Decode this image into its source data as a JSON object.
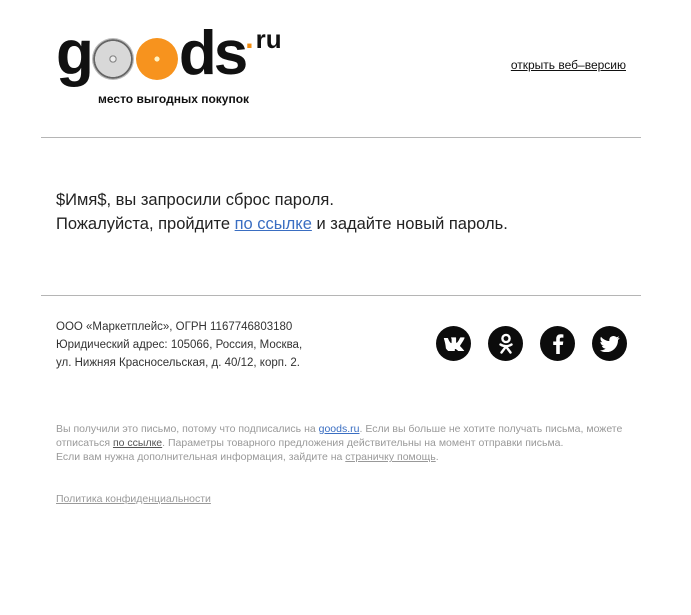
{
  "header": {
    "logo_g": "g",
    "logo_ds": "ds",
    "logo_dot": ".",
    "logo_ru": "ru",
    "tagline": "место выгодных покупок",
    "web_version_link": "открыть веб–версию"
  },
  "message": {
    "line1": "$Имя$, вы запросили сброс пароля.",
    "line2_before": "Пожалуйста, пройдите ",
    "line2_link": "по ссылке",
    "line2_after": " и задайте новый пароль."
  },
  "footer": {
    "legal_line1": "ООО «Маркетплейс», ОГРН 1167746803180",
    "legal_line2": "Юридический адрес: 105066, Россия, Москва,",
    "legal_line3": "ул. Нижняя Красносельская, д. 40/12, корп. 2.",
    "socials": [
      {
        "name": "vk-icon"
      },
      {
        "name": "odnoklassniki-icon"
      },
      {
        "name": "facebook-icon"
      },
      {
        "name": "twitter-icon"
      }
    ],
    "fine_1": "Вы получили это письмо, потому что подписались на ",
    "fine_goods_link": "goods.ru",
    "fine_2": ". Если вы больше не хотите получать письма, можете отписаться ",
    "fine_unsub_link": "по ссылке",
    "fine_3": ". Параметры товарного предложения действительны на момент отправки письма.",
    "fine_4": "Если вам нужна дополнительная информация, зайдите на ",
    "fine_help_link": "страничку помощь",
    "fine_5": ".",
    "policy_link": "Политика конфиденциальности"
  },
  "colors": {
    "link_blue": "#3a6ec2",
    "orange_accent": "#f28c0f",
    "divider": "#b5b5b5"
  }
}
